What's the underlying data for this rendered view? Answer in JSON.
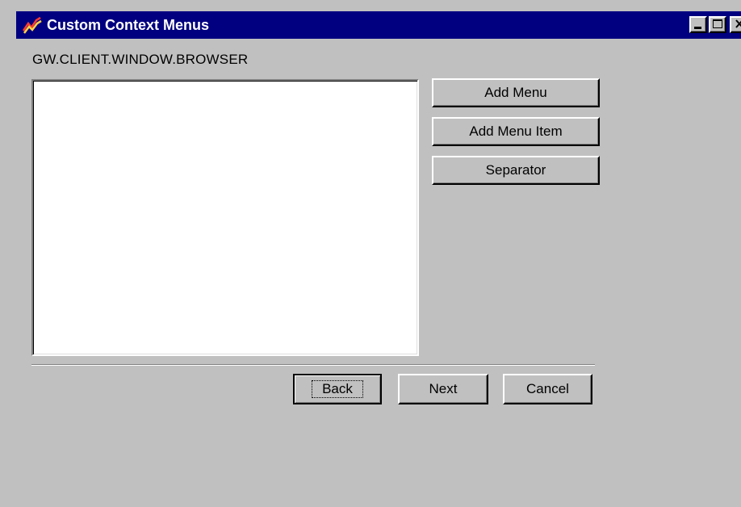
{
  "window": {
    "title": "Custom Context Menus",
    "controls": {
      "minimize_icon": "minimize-icon",
      "maximize_icon": "maximize-icon",
      "close_icon": "close-icon"
    }
  },
  "path_label": "GW.CLIENT.WINDOW.BROWSER",
  "menu_list": {
    "items": []
  },
  "side_buttons": {
    "add_menu": "Add Menu",
    "add_menu_item": "Add Menu Item",
    "separator": "Separator"
  },
  "nav_buttons": {
    "back": "Back",
    "next": "Next",
    "cancel": "Cancel"
  },
  "colors": {
    "titlebar": "#000080",
    "face": "#c0c0c0",
    "listbox": "#ffffff"
  }
}
